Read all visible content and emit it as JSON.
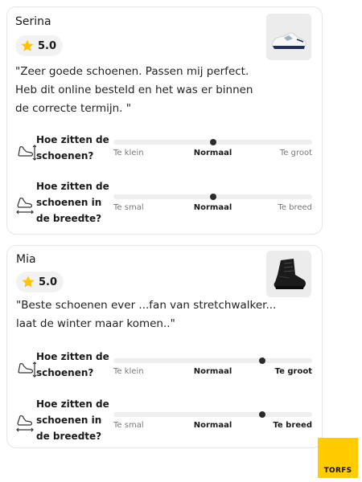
{
  "reviews": [
    {
      "name": "Serina",
      "rating": "5.0",
      "product_image": "white-sneaker",
      "comment": "\"Zeer goede schoenen. Passen mij perfect. Heb dit online besteld en het was er binnen de correcte termijn. \"",
      "fit": [
        {
          "icon": "fit-length-icon",
          "question": "Hoe zitten de schoenen?",
          "labels": [
            "Te klein",
            "Normaal",
            "Te groot"
          ],
          "value": 0.5,
          "selected_label": "Normaal"
        },
        {
          "icon": "fit-width-icon",
          "question": "Hoe zitten de schoenen in de breedte?",
          "labels": [
            "Te smal",
            "Normaal",
            "Te breed"
          ],
          "value": 0.5,
          "selected_label": "Normaal"
        }
      ]
    },
    {
      "name": "Mia",
      "rating": "5.0",
      "product_image": "black-boot",
      "comment": "\"Beste schoenen ever ...fan van stretchwalker... laat de winter maar komen..\"",
      "fit": [
        {
          "icon": "fit-length-icon",
          "question": "Hoe zitten de schoenen?",
          "labels": [
            "Te klein",
            "Normaal",
            "Te groot"
          ],
          "value": 0.75,
          "selected_label": "Te groot"
        },
        {
          "icon": "fit-width-icon",
          "question": "Hoe zitten de schoenen in de breedte?",
          "labels": [
            "Te smal",
            "Normaal",
            "Te breed"
          ],
          "value": 0.75,
          "selected_label": "Te breed"
        }
      ]
    }
  ],
  "brand": {
    "logo_text": "TORFS",
    "color": "#ffcc00"
  },
  "colors": {
    "star": "#ffc200",
    "knob": "#2b2b2b",
    "track": "#efefef"
  }
}
